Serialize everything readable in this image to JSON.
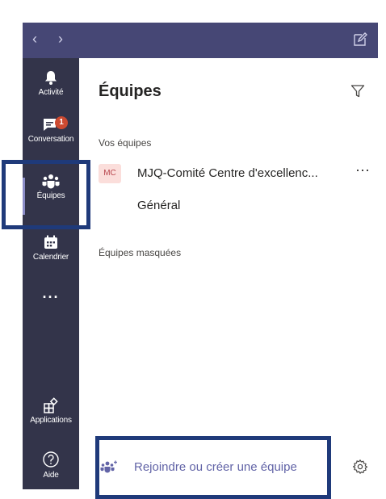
{
  "topbar": {
    "back_icon": "chevron-left-icon",
    "forward_icon": "chevron-right-icon",
    "compose_icon": "compose-icon"
  },
  "rail": {
    "items": [
      {
        "label": "Activité",
        "icon": "bell-icon"
      },
      {
        "label": "Conversation",
        "icon": "chat-icon",
        "badge": "1"
      },
      {
        "label": "Équipes",
        "icon": "teams-icon",
        "active": true
      },
      {
        "label": "Calendrier",
        "icon": "calendar-icon"
      },
      {
        "label": "···",
        "icon": "more-icon"
      },
      {
        "label": "Applications",
        "icon": "apps-icon"
      },
      {
        "label": "Aide",
        "icon": "help-icon"
      }
    ]
  },
  "panel": {
    "title": "Équipes",
    "your_teams_label": "Vos équipes",
    "team": {
      "initials": "MC",
      "name": "MJQ-Comité Centre d'excellenc...",
      "more": "···",
      "channel": "Général"
    },
    "hidden_teams_label": "Équipes masquées",
    "join_label": "Rejoindre ou créer une équipe"
  },
  "colors": {
    "topbar": "#464775",
    "rail": "#33344a",
    "accent": "#6264a7",
    "highlight": "#1f3a7a",
    "badge": "#cc4a31"
  }
}
